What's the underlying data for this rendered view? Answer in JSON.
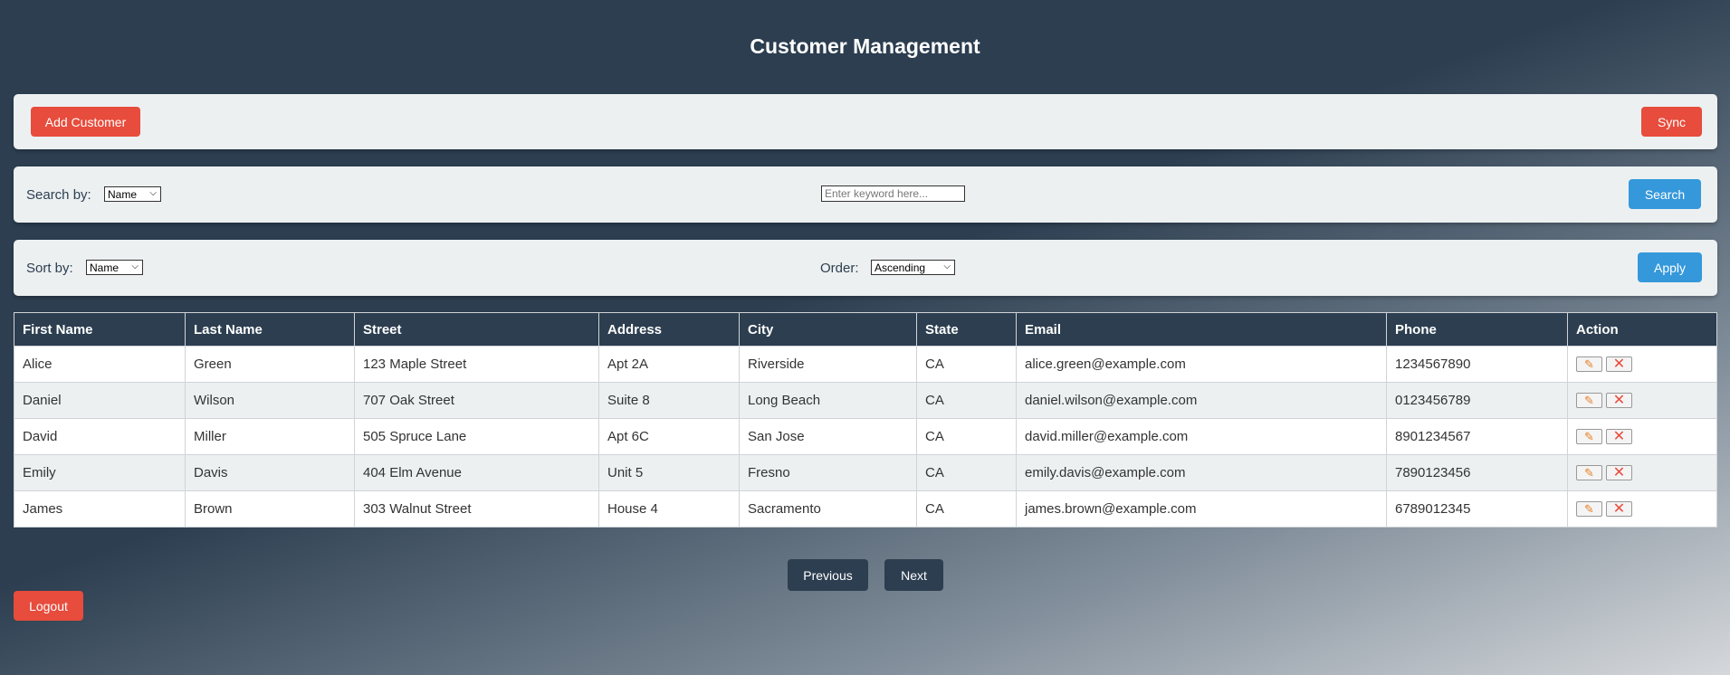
{
  "header": {
    "title": "Customer Management"
  },
  "actions": {
    "add_label": "Add Customer",
    "sync_label": "Sync"
  },
  "search": {
    "label": "Search by:",
    "field_selected": "Name",
    "placeholder": "Enter keyword here...",
    "button_label": "Search"
  },
  "sort": {
    "label": "Sort by:",
    "field_selected": "Name",
    "order_label": "Order:",
    "order_selected": "Ascending",
    "button_label": "Apply"
  },
  "table": {
    "headers": [
      "First Name",
      "Last Name",
      "Street",
      "Address",
      "City",
      "State",
      "Email",
      "Phone",
      "Action"
    ],
    "rows": [
      [
        "Alice",
        "Green",
        "123 Maple Street",
        "Apt 2A",
        "Riverside",
        "CA",
        "alice.green@example.com",
        "1234567890"
      ],
      [
        "Daniel",
        "Wilson",
        "707 Oak Street",
        "Suite 8",
        "Long Beach",
        "CA",
        "daniel.wilson@example.com",
        "0123456789"
      ],
      [
        "David",
        "Miller",
        "505 Spruce Lane",
        "Apt 6C",
        "San Jose",
        "CA",
        "david.miller@example.com",
        "8901234567"
      ],
      [
        "Emily",
        "Davis",
        "404 Elm Avenue",
        "Unit 5",
        "Fresno",
        "CA",
        "emily.davis@example.com",
        "7890123456"
      ],
      [
        "James",
        "Brown",
        "303 Walnut Street",
        "House 4",
        "Sacramento",
        "CA",
        "james.brown@example.com",
        "6789012345"
      ]
    ],
    "row_actions": {
      "edit_icon": "pencil-icon",
      "delete_icon": "close-icon"
    }
  },
  "pagination": {
    "previous_label": "Previous",
    "next_label": "Next"
  },
  "footer": {
    "logout_label": "Logout"
  },
  "colors": {
    "primary_dark": "#2c3e50",
    "danger": "#e74c3c",
    "info": "#3498db",
    "panel": "#ecf0f1"
  }
}
